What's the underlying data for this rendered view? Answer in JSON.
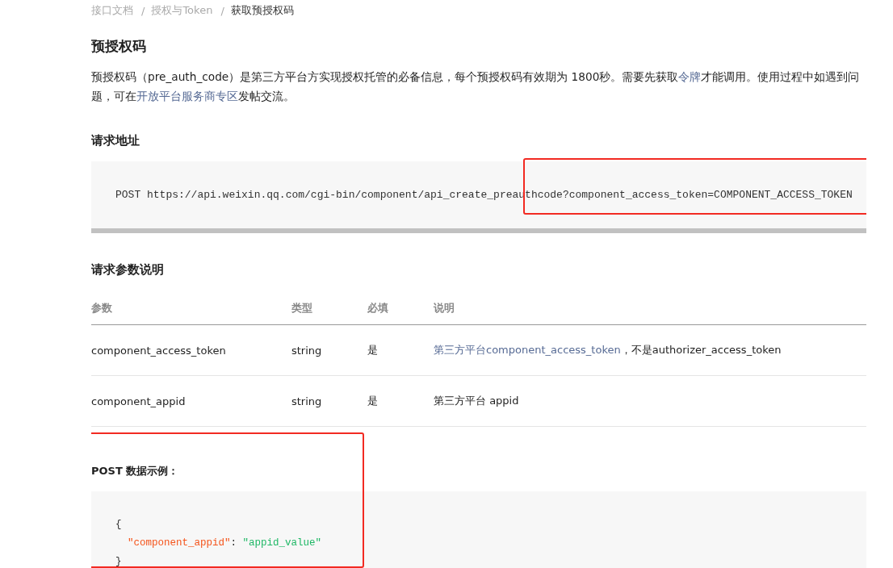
{
  "breadcrumb": [
    {
      "label": "接口文档",
      "current": false
    },
    {
      "label": "授权与Token",
      "current": false
    },
    {
      "label": "获取预授权码",
      "current": true
    }
  ],
  "breadcrumb_separator": "/",
  "title": "预授权码",
  "intro": [
    {
      "kind": "text",
      "text": "预授权码（pre_auth_code）是第三方平台方实现授权托管的必备信息，每个预授权码有效期为 1800秒。需要先获取"
    },
    {
      "kind": "link",
      "text": "令牌"
    },
    {
      "kind": "text",
      "text": "才能调用。使用过程中如遇到问题，可在"
    },
    {
      "kind": "link",
      "text": "开放平台服务商专区"
    },
    {
      "kind": "text",
      "text": "发帖交流。"
    }
  ],
  "request_url": {
    "heading": "请求地址",
    "code": "POST https://api.weixin.qq.com/cgi-bin/component/api_create_preauthcode?component_access_token=COMPONENT_ACCESS_TOKEN"
  },
  "params": {
    "heading": "请求参数说明",
    "columns": [
      "参数",
      "类型",
      "必填",
      "说明"
    ],
    "rows": [
      {
        "name": "component_access_token",
        "type": "string",
        "required": "是",
        "description": [
          {
            "kind": "link",
            "text": "第三方平台component_access_token"
          },
          {
            "kind": "text",
            "text": "，不是authorizer_access_token"
          }
        ]
      },
      {
        "name": "component_appid",
        "type": "string",
        "required": "是",
        "description": [
          {
            "kind": "text",
            "text": "第三方平台 appid"
          }
        ]
      }
    ]
  },
  "post_example": {
    "heading": "POST 数据示例：",
    "lines": [
      {
        "indented": false,
        "tokens": [
          {
            "kind": "punct",
            "text": "{"
          }
        ]
      },
      {
        "indented": true,
        "tokens": [
          {
            "kind": "key",
            "text": "\"component_appid\""
          },
          {
            "kind": "punct",
            "text": ": "
          },
          {
            "kind": "string",
            "text": "\"appid_value\""
          }
        ]
      },
      {
        "indented": false,
        "tokens": [
          {
            "kind": "punct",
            "text": "}"
          }
        ]
      }
    ]
  }
}
